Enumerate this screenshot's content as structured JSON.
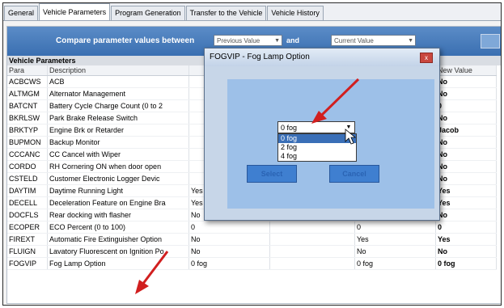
{
  "tabs": [
    "General",
    "Vehicle Parameters",
    "Program Generation",
    "Transfer to the Vehicle",
    "Vehicle History"
  ],
  "compare": {
    "label": "Compare parameter values between",
    "left_select": "Previous Value",
    "and_label": "and",
    "right_select": "Current Value"
  },
  "section_title": "Vehicle Parameters",
  "columns": {
    "para": "Para",
    "desc": "Description",
    "new_value": "New Value"
  },
  "rows": [
    {
      "para": "ACBCWS",
      "desc": "ACB",
      "prev": "",
      "cur": "",
      "nv": "No"
    },
    {
      "para": "ALTMGM",
      "desc": "Alternator Management",
      "prev": "",
      "cur": "",
      "nv": "No"
    },
    {
      "para": "BATCNT",
      "desc": "Battery Cycle Charge Count (0 to 2",
      "prev": "",
      "cur": "",
      "nv": "0"
    },
    {
      "para": "BKRLSW",
      "desc": "Park Brake Release Switch",
      "prev": "",
      "cur": "",
      "nv": "No"
    },
    {
      "para": "BRKTYP",
      "desc": "Engine Brk or Retarder",
      "prev": "",
      "cur": "",
      "nv": "Jacob"
    },
    {
      "para": "BUPMON",
      "desc": "Backup Monitor",
      "prev": "",
      "cur": "",
      "nv": "No"
    },
    {
      "para": "CCCANC",
      "desc": "CC Cancel with Wiper",
      "prev": "",
      "cur": "",
      "nv": "No"
    },
    {
      "para": "CORDO",
      "desc": "RH Cornering ON when door open",
      "prev": "",
      "cur": "",
      "nv": "No"
    },
    {
      "para": "CSTELD",
      "desc": "Customer Electronic Logger Devic",
      "prev": "",
      "cur": "",
      "nv": "No"
    },
    {
      "para": "DAYTIM",
      "desc": "Daytime Running Light",
      "prev": "Yes",
      "cur": "Yes",
      "nv": "Yes"
    },
    {
      "para": "DECELL",
      "desc": "Deceleration Feature on Engine Bra",
      "prev": "Yes",
      "cur": "Yes",
      "nv": "Yes"
    },
    {
      "para": "DOCFLS",
      "desc": "Rear docking with flasher",
      "prev": "No",
      "cur": "No",
      "nv": "No"
    },
    {
      "para": "ECOPER",
      "desc": "ECO Percent (0 to 100)",
      "prev": "0",
      "cur": "0",
      "nv": "0"
    },
    {
      "para": "FIREXT",
      "desc": "Automatic Fire Extinguisher Option",
      "prev": "No",
      "cur": "Yes",
      "nv": "Yes"
    },
    {
      "para": "FLUIGN",
      "desc": "Lavatory Fluorescent on Ignition Po",
      "prev": "No",
      "cur": "No",
      "nv": "No"
    },
    {
      "para": "FOGVIP",
      "desc": "Fog Lamp Option",
      "prev": "0 fog",
      "cur": "0 fog",
      "nv": "0 fog"
    }
  ],
  "dialog": {
    "title": "FOGVIP - Fog Lamp Option",
    "close_glyph": "x",
    "selected": "0 fog",
    "options": [
      "0 fog",
      "2 fog",
      "4 fog"
    ],
    "select_button": "Select",
    "cancel_button": "Cancel"
  },
  "colors": {
    "accent": "#3a6fb1",
    "annotation_arrow": "#d11f1f"
  }
}
